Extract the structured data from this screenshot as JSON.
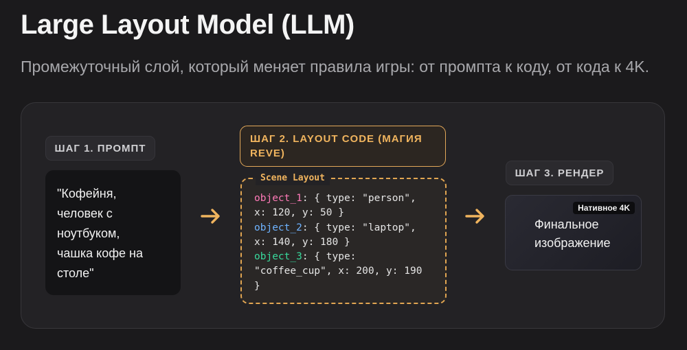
{
  "header": {
    "title": "Large Layout Model (LLM)",
    "subtitle": "Промежуточный слой, который меняет правила игры: от промпта к коду, от кода к 4K."
  },
  "steps": {
    "step1": {
      "label": "ШАГ 1. ПРОМПТ",
      "prompt_lines": [
        "\"Кофейня,",
        "человек с",
        "ноутбуком,",
        "чашка кофе на",
        "столе\""
      ]
    },
    "step2": {
      "label_line1": "ШАГ 2. LAYOUT CODE (МАГИЯ",
      "label_line2": "REVE)",
      "code_tag": "Scene Layout",
      "code": {
        "obj1_key": "object_1",
        "obj1_line1": ": { type: \"person\",",
        "obj1_line2": "x: 120, y: 50 }",
        "obj2_key": "object_2",
        "obj2_line1": ": { type: \"laptop\",",
        "obj2_line2": "x: 140, y: 180 }",
        "obj3_key": "object_3",
        "obj3_line1": ": { type:",
        "obj3_line2": "\"coffee_cup\", x: 200, y: 190",
        "obj3_line3": "}"
      }
    },
    "step3": {
      "label": "ШАГ 3. РЕНДЕР",
      "badge": "Нативное 4K",
      "render_line1": "Финальное",
      "render_line2": "изображение"
    }
  },
  "colors": {
    "background": "#1b1a1c",
    "accent_orange": "#f0b45e",
    "code_pink": "#ff7ab8",
    "code_blue": "#6eb3ff",
    "code_green": "#38d99c"
  },
  "icons": {
    "arrow": "arrow-right-icon"
  }
}
